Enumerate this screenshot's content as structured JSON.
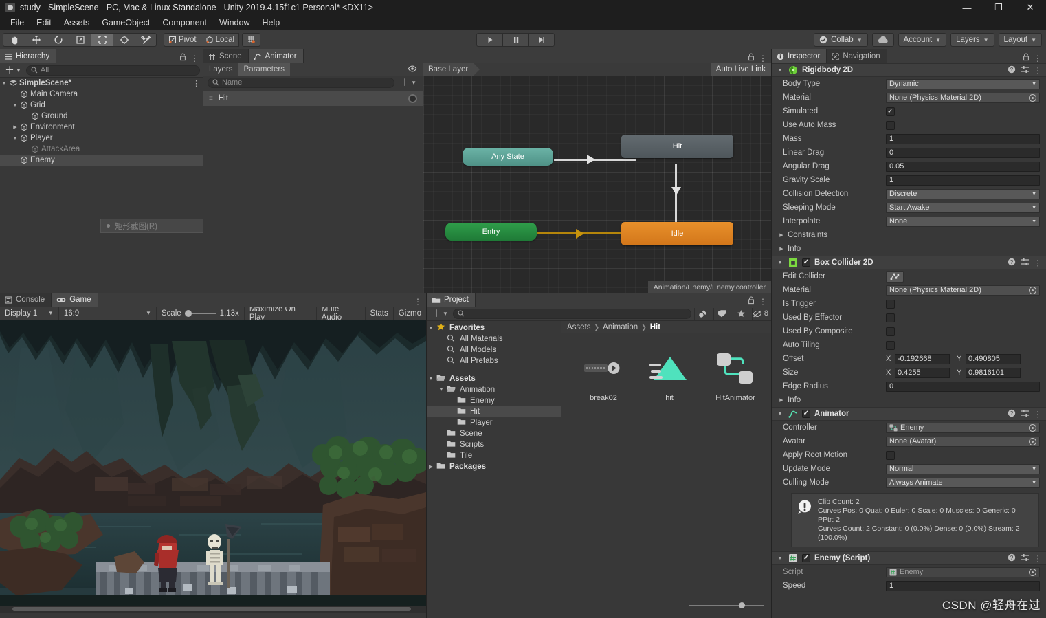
{
  "window": {
    "title": "study - SimpleScene - PC, Mac & Linux Standalone - Unity 2019.4.15f1c1 Personal* <DX11>",
    "minimize": "—",
    "maximize": "❐",
    "close": "✕"
  },
  "menu": [
    "File",
    "Edit",
    "Assets",
    "GameObject",
    "Component",
    "Window",
    "Help"
  ],
  "toolbar": {
    "tools": [
      "hand-tool",
      "move-tool",
      "rotate-tool",
      "scale-tool",
      "rect-tool",
      "transform-tool",
      "custom-tool"
    ],
    "pivot_label": "Pivot",
    "local_label": "Local",
    "collab_label": "Collab",
    "account_label": "Account",
    "layers_label": "Layers",
    "layout_label": "Layout"
  },
  "hierarchy": {
    "tab": "Hierarchy",
    "search_placeholder": "All",
    "context_tip": "矩形截图(R)",
    "items": [
      {
        "label": "SimpleScene*",
        "depth": 0,
        "arrow": "open",
        "icon": "scene-icon",
        "selected": false,
        "dim": false
      },
      {
        "label": "Main Camera",
        "depth": 1,
        "arrow": "none",
        "icon": "cube-icon",
        "selected": false,
        "dim": false
      },
      {
        "label": "Grid",
        "depth": 1,
        "arrow": "open",
        "icon": "cube-icon",
        "selected": false,
        "dim": false
      },
      {
        "label": "Ground",
        "depth": 2,
        "arrow": "none",
        "icon": "cube-icon",
        "selected": false,
        "dim": false
      },
      {
        "label": "Environment",
        "depth": 1,
        "arrow": "closed",
        "icon": "cube-icon",
        "selected": false,
        "dim": false
      },
      {
        "label": "Player",
        "depth": 1,
        "arrow": "open",
        "icon": "cube-icon",
        "selected": false,
        "dim": false
      },
      {
        "label": "AttackArea",
        "depth": 2,
        "arrow": "none",
        "icon": "cube-icon",
        "selected": false,
        "dim": true
      },
      {
        "label": "Enemy",
        "depth": 1,
        "arrow": "none",
        "icon": "cube-icon",
        "selected": true,
        "dim": false
      }
    ]
  },
  "animator": {
    "tabs": [
      {
        "label": "Scene",
        "icon": "grid-icon",
        "active": false
      },
      {
        "label": "Animator",
        "icon": "animator-icon",
        "active": true
      }
    ],
    "subtabs": [
      {
        "label": "Layers",
        "active": false
      },
      {
        "label": "Parameters",
        "active": true
      }
    ],
    "name_placeholder": "Name",
    "layer_name": "Hit",
    "breadcrumb": "Base Layer",
    "auto_live_link": "Auto Live Link",
    "controller_path": "Animation/Enemy/Enemy.controller",
    "nodes": [
      {
        "id": "any",
        "label": "Any State"
      },
      {
        "id": "entry",
        "label": "Entry"
      },
      {
        "id": "hit",
        "label": "Hit"
      },
      {
        "id": "idle",
        "label": "Idle"
      }
    ]
  },
  "inspector": {
    "tabs": [
      {
        "label": "Inspector",
        "icon": "info-icon",
        "active": true
      },
      {
        "label": "Navigation",
        "icon": "navigation-icon",
        "active": false
      }
    ],
    "components": [
      {
        "name": "Rigidbody 2D",
        "icon": "rigidbody2d-icon",
        "has_enable_checkbox": false,
        "rows": [
          {
            "label": "Body Type",
            "type": "dropdown",
            "value": "Dynamic"
          },
          {
            "label": "Material",
            "type": "object",
            "value": "None (Physics Material 2D)"
          },
          {
            "label": "Simulated",
            "type": "checkbox",
            "value": true
          },
          {
            "label": "Use Auto Mass",
            "type": "checkbox",
            "value": false
          },
          {
            "label": "Mass",
            "type": "number",
            "value": "1"
          },
          {
            "label": "Linear Drag",
            "type": "number",
            "value": "0"
          },
          {
            "label": "Angular Drag",
            "type": "number",
            "value": "0.05"
          },
          {
            "label": "Gravity Scale",
            "type": "number",
            "value": "1"
          },
          {
            "label": "Collision Detection",
            "type": "dropdown",
            "value": "Discrete"
          },
          {
            "label": "Sleeping Mode",
            "type": "dropdown",
            "value": "Start Awake"
          },
          {
            "label": "Interpolate",
            "type": "dropdown",
            "value": "None"
          },
          {
            "label": "Constraints",
            "type": "foldout",
            "value": ""
          },
          {
            "label": "Info",
            "type": "foldout",
            "value": ""
          }
        ]
      },
      {
        "name": "Box Collider 2D",
        "icon": "boxcollider2d-icon",
        "has_enable_checkbox": true,
        "enabled": true,
        "rows": [
          {
            "label": "Edit Collider",
            "type": "editcollider",
            "value": ""
          },
          {
            "label": "Material",
            "type": "object",
            "value": "None (Physics Material 2D)"
          },
          {
            "label": "Is Trigger",
            "type": "checkbox",
            "value": false
          },
          {
            "label": "Used By Effector",
            "type": "checkbox",
            "value": false
          },
          {
            "label": "Used By Composite",
            "type": "checkbox",
            "value": false
          },
          {
            "label": "Auto Tiling",
            "type": "checkbox",
            "value": false
          },
          {
            "label": "Offset",
            "type": "vector2",
            "x": "-0.192668",
            "y": "0.490805"
          },
          {
            "label": "Size",
            "type": "vector2",
            "x": "0.4255",
            "y": "0.9816101"
          },
          {
            "label": "Edge Radius",
            "type": "number",
            "value": "0"
          },
          {
            "label": "Info",
            "type": "foldout",
            "value": ""
          }
        ]
      },
      {
        "name": "Animator",
        "icon": "animator-comp-icon",
        "has_enable_checkbox": true,
        "enabled": true,
        "rows": [
          {
            "label": "Controller",
            "type": "object",
            "value": "Enemy",
            "badge": "controller"
          },
          {
            "label": "Avatar",
            "type": "object",
            "value": "None (Avatar)"
          },
          {
            "label": "Apply Root Motion",
            "type": "checkbox",
            "value": false
          },
          {
            "label": "Update Mode",
            "type": "dropdown",
            "value": "Normal"
          },
          {
            "label": "Culling Mode",
            "type": "dropdown",
            "value": "Always Animate"
          }
        ],
        "info_lines": [
          "Clip Count: 2",
          "Curves Pos: 0 Quat: 0 Euler: 0 Scale: 0 Muscles: 0 Generic: 0 PPtr: 2",
          "Curves Count: 2 Constant: 0 (0.0%) Dense: 0 (0.0%) Stream: 2",
          "(100.0%)"
        ]
      },
      {
        "name": "Enemy (Script)",
        "icon": "script-icon",
        "has_enable_checkbox": true,
        "enabled": true,
        "rows": [
          {
            "label": "Script",
            "type": "object-dim",
            "value": "Enemy",
            "badge": "script"
          },
          {
            "label": "Speed",
            "type": "number",
            "value": "1"
          }
        ]
      }
    ]
  },
  "game": {
    "tabs": [
      {
        "label": "Console",
        "icon": "console-icon",
        "active": false
      },
      {
        "label": "Game",
        "icon": "gamepad-icon",
        "active": true
      }
    ],
    "display": "Display 1",
    "aspect": "16:9",
    "scale_label": "Scale",
    "scale_value": "1.13x",
    "maximize_on_play": "Maximize On Play",
    "mute_audio": "Mute Audio",
    "stats": "Stats",
    "gizmos": "Gizmo"
  },
  "project": {
    "tab": "Project",
    "search_placeholder": "",
    "hidden_count": "8",
    "breadcrumbs": [
      "Assets",
      "Animation",
      "Hit"
    ],
    "tree": [
      {
        "label": "Favorites",
        "depth": 0,
        "arrow": "open",
        "icon": "star-icon",
        "bold": true,
        "selected": false
      },
      {
        "label": "All Materials",
        "depth": 1,
        "arrow": "none",
        "icon": "search-icon",
        "bold": false,
        "selected": false
      },
      {
        "label": "All Models",
        "depth": 1,
        "arrow": "none",
        "icon": "search-icon",
        "bold": false,
        "selected": false
      },
      {
        "label": "All Prefabs",
        "depth": 1,
        "arrow": "none",
        "icon": "search-icon",
        "bold": false,
        "selected": false
      },
      {
        "label": "",
        "depth": 0,
        "arrow": "none",
        "icon": "spacer",
        "bold": false,
        "selected": false
      },
      {
        "label": "Assets",
        "depth": 0,
        "arrow": "open",
        "icon": "folder-open-icon",
        "bold": true,
        "selected": false
      },
      {
        "label": "Animation",
        "depth": 1,
        "arrow": "open",
        "icon": "folder-open-icon",
        "bold": false,
        "selected": false
      },
      {
        "label": "Enemy",
        "depth": 2,
        "arrow": "none",
        "icon": "folder-icon",
        "bold": false,
        "selected": false
      },
      {
        "label": "Hit",
        "depth": 2,
        "arrow": "none",
        "icon": "folder-icon",
        "bold": false,
        "selected": true
      },
      {
        "label": "Player",
        "depth": 2,
        "arrow": "none",
        "icon": "folder-icon",
        "bold": false,
        "selected": false
      },
      {
        "label": "Scene",
        "depth": 1,
        "arrow": "none",
        "icon": "folder-icon",
        "bold": false,
        "selected": false
      },
      {
        "label": "Scripts",
        "depth": 1,
        "arrow": "none",
        "icon": "folder-icon",
        "bold": false,
        "selected": false
      },
      {
        "label": "Tile",
        "depth": 1,
        "arrow": "none",
        "icon": "folder-icon",
        "bold": false,
        "selected": false
      },
      {
        "label": "Packages",
        "depth": 0,
        "arrow": "closed",
        "icon": "folder-icon",
        "bold": true,
        "selected": false
      }
    ],
    "assets": [
      {
        "name": "break02",
        "icon": "animation-clip-icon"
      },
      {
        "name": "hit",
        "icon": "animation-icon"
      },
      {
        "name": "HitAnimator",
        "icon": "animator-controller-icon"
      }
    ]
  },
  "watermark": "CSDN @轻舟在过",
  "colors": {
    "accent_teal": "#4fd2b0",
    "node_any": "#5ea79a",
    "node_entry": "#2b8f43",
    "node_hit": "#5a6267",
    "node_idle": "#e08a2a",
    "panel_bg": "#383838",
    "header_bg": "#3c3c3c"
  }
}
